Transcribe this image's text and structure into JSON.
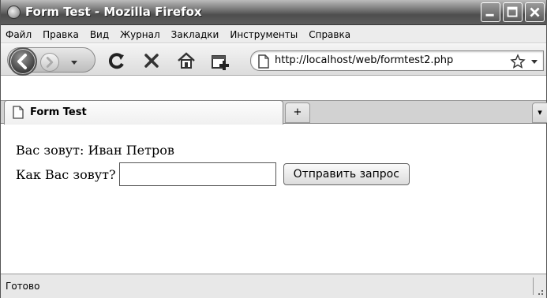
{
  "window": {
    "title": "Form Test - Mozilla Firefox"
  },
  "menu": {
    "items": [
      {
        "label": "Файл"
      },
      {
        "label": "Правка"
      },
      {
        "label": "Вид"
      },
      {
        "label": "Журнал"
      },
      {
        "label": "Закладки"
      },
      {
        "label": "Инструменты"
      },
      {
        "label": "Справка"
      }
    ]
  },
  "toolbar": {
    "icons": [
      "back-icon",
      "forward-icon",
      "nav-dropdown-icon",
      "reload-icon",
      "stop-icon",
      "home-icon",
      "new-tab-icon",
      "page-icon",
      "bookmark-star-icon",
      "url-dropdown-icon"
    ]
  },
  "address": {
    "url": "http://localhost/web/formtest2.php"
  },
  "tabs": {
    "active_label": "Form Test",
    "new_tab_symbol": "+",
    "list_symbol": "▾"
  },
  "page": {
    "greeting": "Вас зовут: Иван Петров",
    "prompt_label": "Как Вас зовут?",
    "name_value": "",
    "submit_label": "Отправить запрос"
  },
  "status": {
    "text": "Готово"
  }
}
